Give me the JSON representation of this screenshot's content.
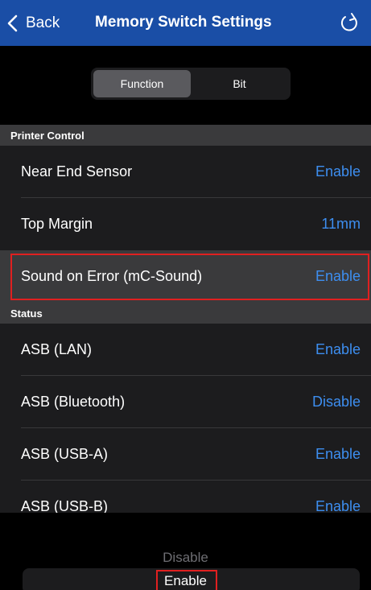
{
  "nav": {
    "back_label": "Back",
    "title": "Memory Switch Settings",
    "back_icon": "chevron-left-icon",
    "refresh_icon": "refresh-icon"
  },
  "segment": {
    "options": [
      "Function",
      "Bit"
    ],
    "selected": "Function"
  },
  "sections": [
    {
      "header": "Printer Control",
      "rows": [
        {
          "label": "Near End Sensor",
          "value": "Enable"
        },
        {
          "label": "Top Margin",
          "value": "11mm"
        },
        {
          "label": "Sound on Error (mC-Sound)",
          "value": "Enable",
          "highlighted": true
        }
      ]
    },
    {
      "header": "Status",
      "rows": [
        {
          "label": "ASB (LAN)",
          "value": "Enable"
        },
        {
          "label": "ASB (Bluetooth)",
          "value": "Disable"
        },
        {
          "label": "ASB (USB-A)",
          "value": "Enable"
        },
        {
          "label": "ASB (USB-B)",
          "value": "Enable"
        }
      ]
    }
  ],
  "picker": {
    "options": [
      "Disable",
      "Enable"
    ],
    "selected": "Enable"
  },
  "colors": {
    "nav_bg": "#1a4ea6",
    "accent": "#3d8ef0",
    "highlight": "#e02020"
  }
}
